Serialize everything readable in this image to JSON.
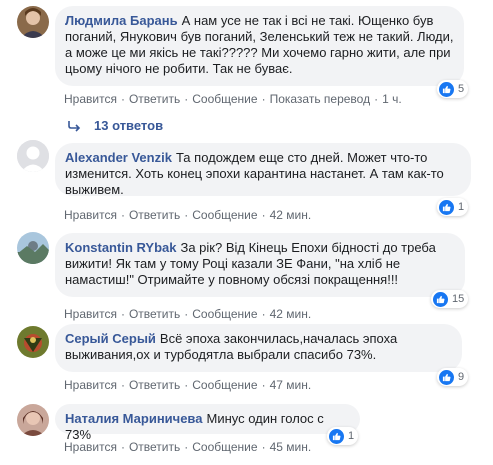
{
  "colors": {
    "author": "#385898",
    "bubble": "#f2f3f5",
    "meta": "#606770",
    "like": "#1877f2"
  },
  "icons": {
    "like": "thumbs-up-icon",
    "reply": "reply-arrow-icon"
  },
  "comments": [
    {
      "author": "Людмила Барань",
      "text": "А нам усе не так і всі не такі. Ющенко був поганий, Янукович був поганий, Зеленський теж не такий. Люди, а може це ми якісь не такі????? Ми хочемо гарно жити, але при цьому нічого не робити. Так не буває.",
      "like": "Нравится",
      "reply": "Ответить",
      "message": "Сообщение",
      "translate": "Показать перевод",
      "time": "1 ч.",
      "reactions": "5"
    },
    {
      "author": "Alexander Venzik",
      "text": "Та подождем еще сто дней. Может что-то изменится. Хоть конец эпохи карантина настанет. А там как-то выживем.",
      "like": "Нравится",
      "reply": "Ответить",
      "message": "Сообщение",
      "time": "42 мин.",
      "reactions": "1"
    },
    {
      "author": "Konstantin RYbak",
      "text": "За рік? Від Кінець Епохи бідності до треба вижити! Як там у тому Році казали ЗЕ Фани, \"на хліб не намастиш!\" Отримайте у повному обсязі покращення!!!",
      "like": "Нравится",
      "reply": "Ответить",
      "message": "Сообщение",
      "time": "42 мин.",
      "reactions": "15"
    },
    {
      "author": "Серый Серый",
      "text": "Всё эпоха закончилась,началась эпоха выживания,ох и турбодятла выбрали спасибо 73%.",
      "like": "Нравится",
      "reply": "Ответить",
      "message": "Сообщение",
      "time": "47 мин.",
      "reactions": "9"
    },
    {
      "author": "Наталия Мариничева",
      "text": "Минус один голос с 73%",
      "like": "Нравится",
      "reply": "Ответить",
      "message": "Сообщение",
      "time": "45 мин.",
      "reactions": "1"
    }
  ],
  "replies_label": "13 ответов"
}
